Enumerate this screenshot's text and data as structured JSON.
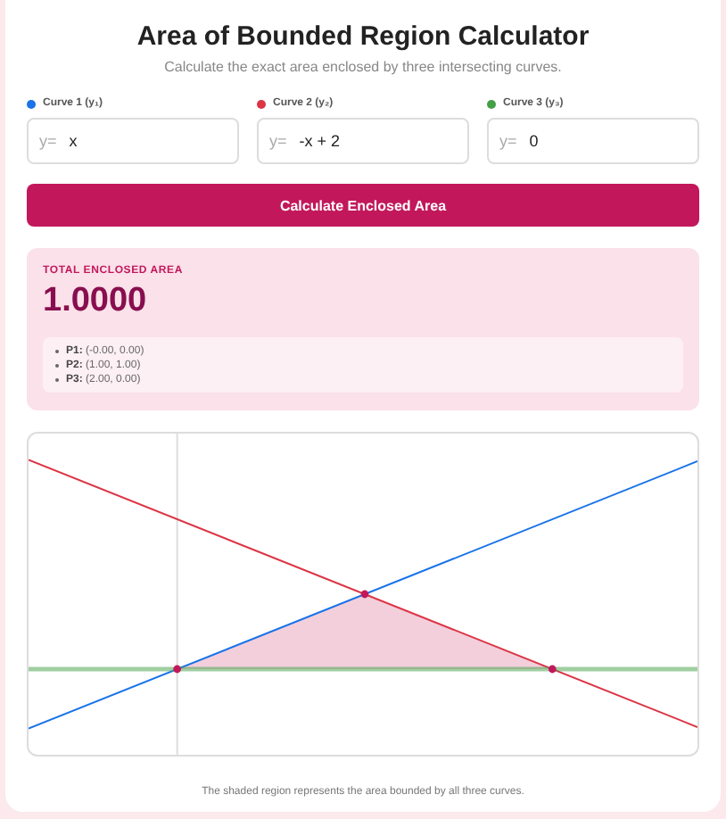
{
  "title": "Area of Bounded Region Calculator",
  "subtitle": "Calculate the exact area enclosed by three intersecting curves.",
  "curves": [
    {
      "label": "Curve 1 (y₁)",
      "color": "#1a73e8",
      "prefix": "y=",
      "value": "x"
    },
    {
      "label": "Curve 2 (y₂)",
      "color": "#dc3545",
      "prefix": "y=",
      "value": "-x + 2"
    },
    {
      "label": "Curve 3 (y₃)",
      "color": "#43a047",
      "prefix": "y=",
      "value": "0"
    }
  ],
  "button": "Calculate Enclosed Area",
  "result": {
    "label": "TOTAL ENCLOSED AREA",
    "value": "1.0000",
    "points": [
      "**P1:** (-0.00, 0.00)",
      "**P2:** (1.00, 1.00)",
      "**P3:** (2.00, 0.00)"
    ]
  },
  "caption": "The shaded region represents the area bounded by all three curves."
}
